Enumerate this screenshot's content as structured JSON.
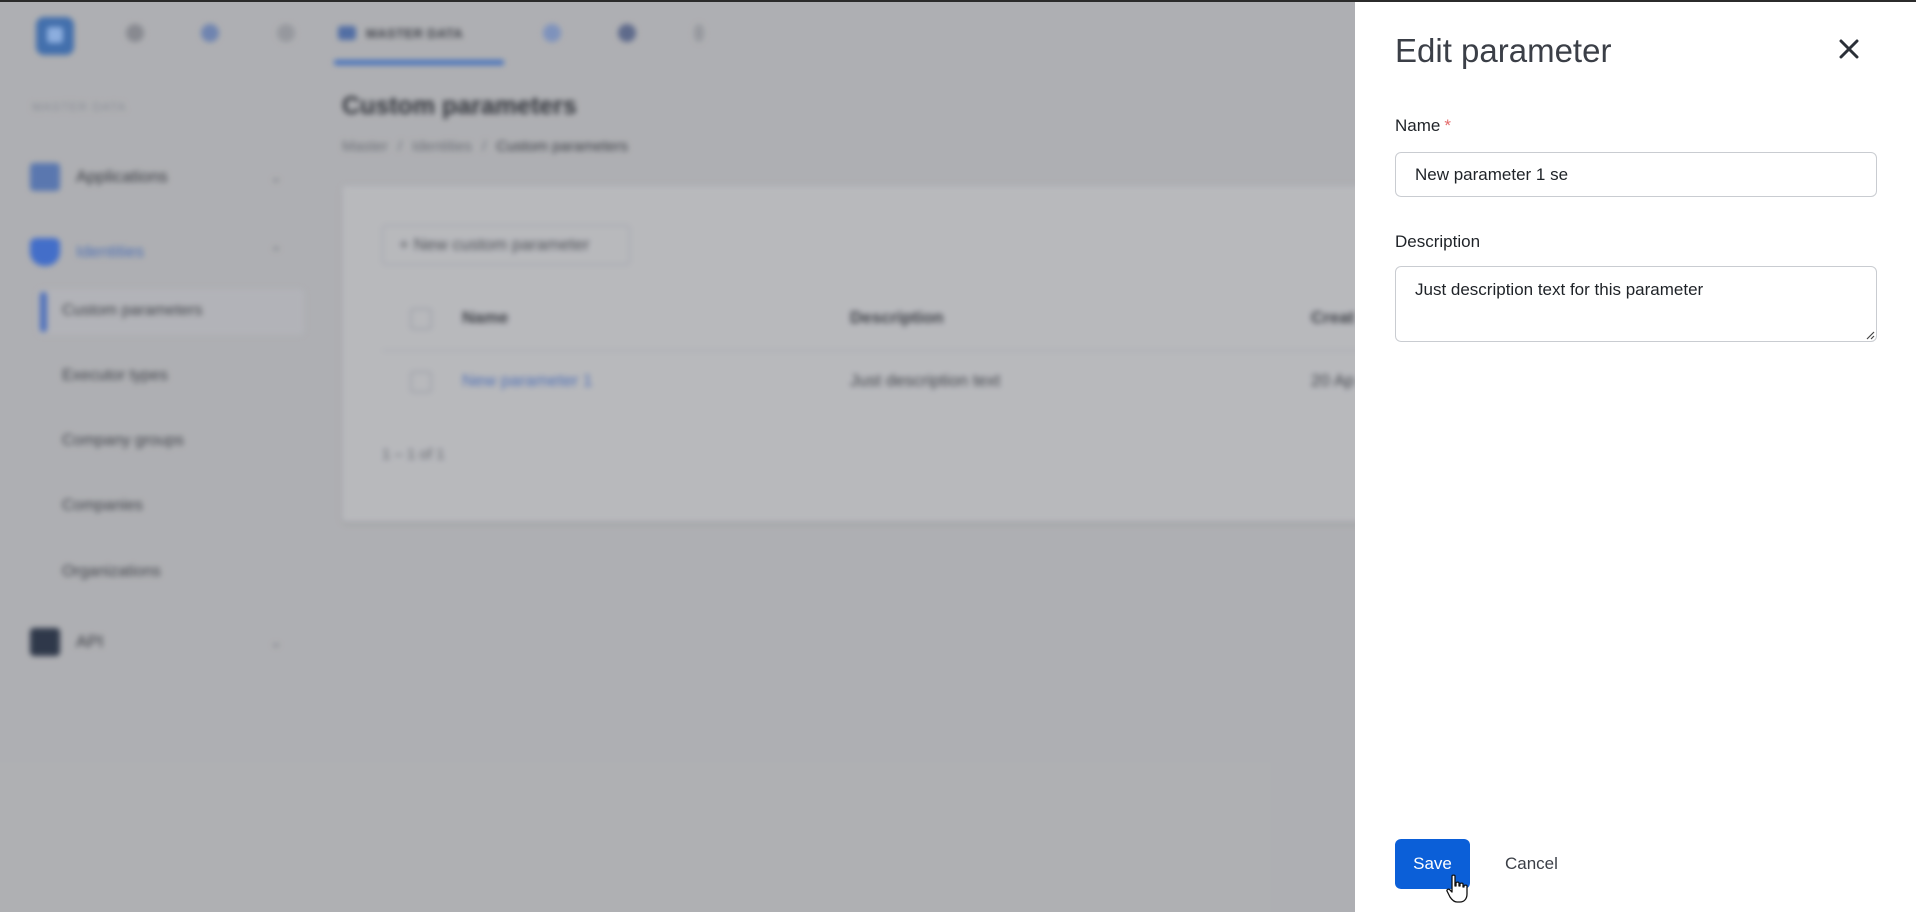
{
  "background": {
    "app_section": "MASTER DATA",
    "active_tab": "MASTER DATA",
    "sidebar": {
      "section_title": "MASTER DATA",
      "groups": [
        {
          "label": "Applications",
          "icon": "applications-icon"
        },
        {
          "label": "Identities",
          "icon": "shield-icon"
        },
        {
          "label": "API",
          "icon": "api-icon"
        }
      ],
      "items": [
        "Custom parameters",
        "Executor types",
        "Company groups",
        "Companies",
        "Organizations"
      ]
    },
    "page_title": "Custom parameters",
    "breadcrumb": [
      "Master",
      "Identities",
      "Custom parameters"
    ],
    "new_button": "+ New custom parameter",
    "table": {
      "columns": [
        "Name",
        "Description",
        "Creat"
      ],
      "rows": [
        {
          "name": "New parameter 1",
          "description": "Just description text",
          "created": "20 Ap"
        }
      ]
    },
    "pagination": "1 – 1 of 1"
  },
  "drawer": {
    "title": "Edit parameter",
    "close_icon": "close-icon",
    "name_label": "Name",
    "required_mark": "*",
    "name_value": "New parameter 1 se",
    "description_label": "Description",
    "description_value": "Just description text for this parameter",
    "save_label": "Save",
    "cancel_label": "Cancel"
  },
  "colors": {
    "primary": "#0b5fd8",
    "required": "#e46a6a",
    "overlay": "#b4b5b8"
  }
}
